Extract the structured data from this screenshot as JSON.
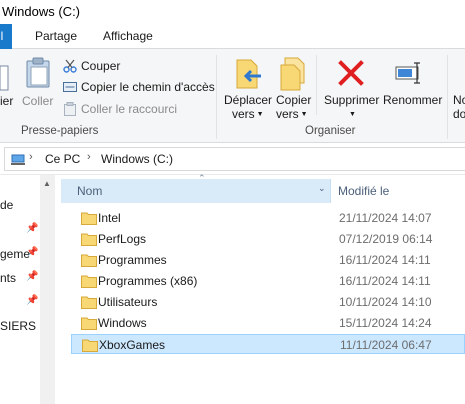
{
  "window": {
    "title": "Windows (C:)"
  },
  "tabs": {
    "active_partial": "il",
    "share": "Partage",
    "view": "Affichage"
  },
  "ribbon": {
    "paste_partial": "ier",
    "copy": "Coller",
    "cut": "Couper",
    "copy_path": "Copier le chemin d'accès",
    "paste_shortcut": "Coller le raccourci",
    "clipboard_group": "Presse-papiers",
    "move_to_line1": "Déplacer",
    "move_to_line2": "vers",
    "copy_to_line1": "Copier",
    "copy_to_line2": "vers",
    "delete": "Supprimer",
    "rename": "Renommer",
    "new_partial": "No",
    "new_partial2": "do",
    "organize_group": "Organiser"
  },
  "address": {
    "crumb_1": "Ce PC",
    "crumb_2": "Windows (C:)"
  },
  "nav": {
    "items": [
      "de",
      "geme",
      "nts",
      "SIERS S"
    ]
  },
  "columns": {
    "name": "Nom",
    "modified": "Modifié le"
  },
  "files": [
    {
      "name": "Intel",
      "modified": "21/11/2024 14:07"
    },
    {
      "name": "PerfLogs",
      "modified": "07/12/2019 06:14"
    },
    {
      "name": "Programmes",
      "modified": "16/11/2024 14:11"
    },
    {
      "name": "Programmes (x86)",
      "modified": "16/11/2024 14:11"
    },
    {
      "name": "Utilisateurs",
      "modified": "10/11/2024 14:10"
    },
    {
      "name": "Windows",
      "modified": "15/11/2024 14:24"
    },
    {
      "name": "XboxGames",
      "modified": "11/11/2024 06:47"
    }
  ],
  "colors": {
    "accent": "#1979ca",
    "selected_bg": "#cce8ff",
    "header_bg": "#d9ebf9",
    "folder": "#f8d775"
  }
}
